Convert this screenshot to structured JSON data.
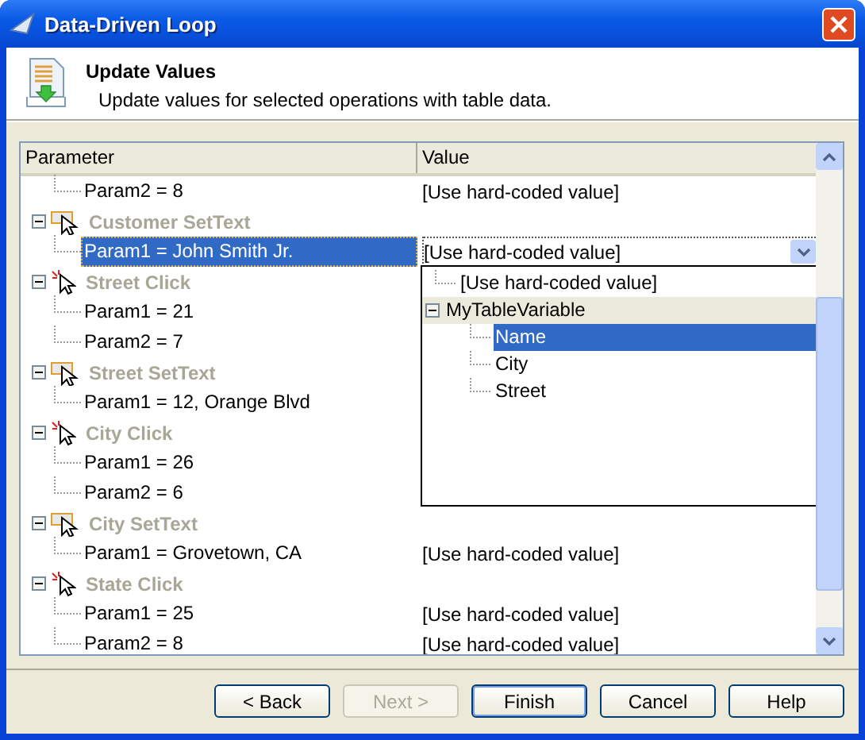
{
  "window": {
    "title": "Data-Driven Loop"
  },
  "header": {
    "title": "Update Values",
    "subtitle": "Update values for selected operations with table data."
  },
  "table": {
    "columns": [
      "Parameter",
      "Value"
    ],
    "rows": [
      {
        "kind": "param",
        "label": "Param2 = 8",
        "value": "[Use hard-coded value]",
        "selected": false
      },
      {
        "kind": "settext",
        "label": "Customer SetText",
        "expanded": true,
        "children": [
          {
            "kind": "param",
            "label": "Param1 = John Smith Jr.",
            "value": "[Use hard-coded value]",
            "selected": true,
            "editing": true
          }
        ]
      },
      {
        "kind": "click",
        "label": "Street Click",
        "expanded": true,
        "children": [
          {
            "kind": "param",
            "label": "Param1 = 21",
            "selected": false
          },
          {
            "kind": "param",
            "label": "Param2 = 7",
            "selected": false
          }
        ]
      },
      {
        "kind": "settext",
        "label": "Street SetText",
        "expanded": true,
        "children": [
          {
            "kind": "param",
            "label": "Param1 = 12, Orange Blvd",
            "selected": false
          }
        ]
      },
      {
        "kind": "click",
        "label": "City Click",
        "expanded": true,
        "children": [
          {
            "kind": "param",
            "label": "Param1 = 26",
            "selected": false
          },
          {
            "kind": "param",
            "label": "Param2 = 6",
            "selected": false
          }
        ]
      },
      {
        "kind": "settext",
        "label": "City SetText",
        "expanded": true,
        "children": [
          {
            "kind": "param",
            "label": "Param1 = Grovetown, CA",
            "value": "[Use hard-coded value]",
            "selected": false
          }
        ]
      },
      {
        "kind": "click",
        "label": "State Click",
        "expanded": true,
        "children": [
          {
            "kind": "param",
            "label": "Param1 = 25",
            "value": "[Use hard-coded value]",
            "selected": false
          },
          {
            "kind": "param",
            "label": "Param2 = 8",
            "value": "[Use hard-coded value]",
            "selected": false
          }
        ]
      }
    ]
  },
  "dropdown": {
    "items": [
      {
        "label": "[Use hard-coded value]",
        "selected": false
      },
      {
        "label": "MyTableVariable",
        "selected": false,
        "expanded": true,
        "children": [
          {
            "label": "Name",
            "selected": true
          },
          {
            "label": "City",
            "selected": false
          },
          {
            "label": "Street",
            "selected": false
          }
        ]
      }
    ]
  },
  "buttons": [
    {
      "label": "< Back",
      "disabled": false,
      "default": false
    },
    {
      "label": "Next >",
      "disabled": true,
      "default": false
    },
    {
      "label": "Finish",
      "disabled": false,
      "default": true
    },
    {
      "label": "Cancel",
      "disabled": false,
      "default": false
    },
    {
      "label": "Help",
      "disabled": false,
      "default": false
    }
  ]
}
